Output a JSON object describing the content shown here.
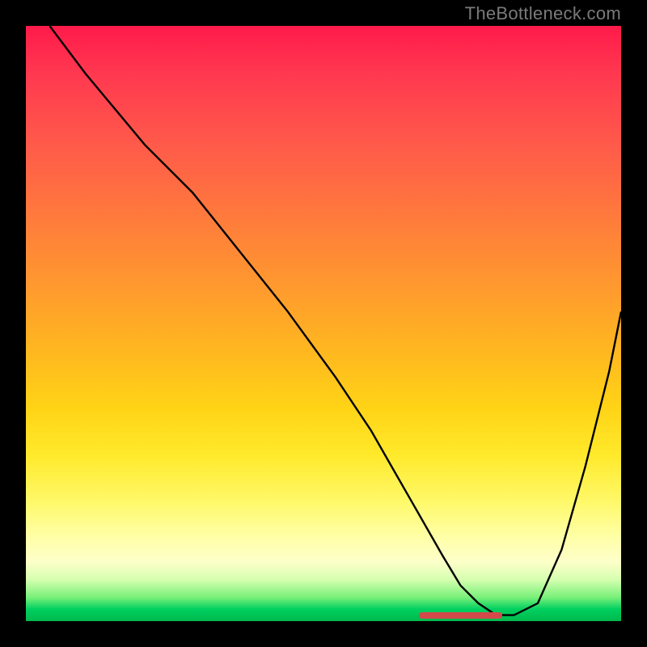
{
  "watermark": "TheBottleneck.com",
  "chart_data": {
    "type": "line",
    "title": "",
    "xlabel": "",
    "ylabel": "",
    "xlim": [
      0,
      100
    ],
    "ylim": [
      0,
      100
    ],
    "series": [
      {
        "name": "curve",
        "x": [
          4,
          10,
          20,
          28,
          36,
          44,
          52,
          58,
          62,
          66,
          70,
          73,
          76,
          79,
          82,
          86,
          90,
          94,
          98,
          100
        ],
        "y": [
          100,
          92,
          80,
          72,
          62,
          52,
          41,
          32,
          25,
          18,
          11,
          6,
          3,
          1,
          1,
          3,
          12,
          26,
          42,
          52
        ]
      }
    ],
    "marker": {
      "x_start": 66,
      "x_end": 80,
      "y": 1
    },
    "gradient_stops": [
      {
        "pos": 0,
        "color": "#ff1a4a"
      },
      {
        "pos": 55,
        "color": "#ffb81f"
      },
      {
        "pos": 80,
        "color": "#fff96a"
      },
      {
        "pos": 100,
        "color": "#00b84c"
      }
    ]
  }
}
